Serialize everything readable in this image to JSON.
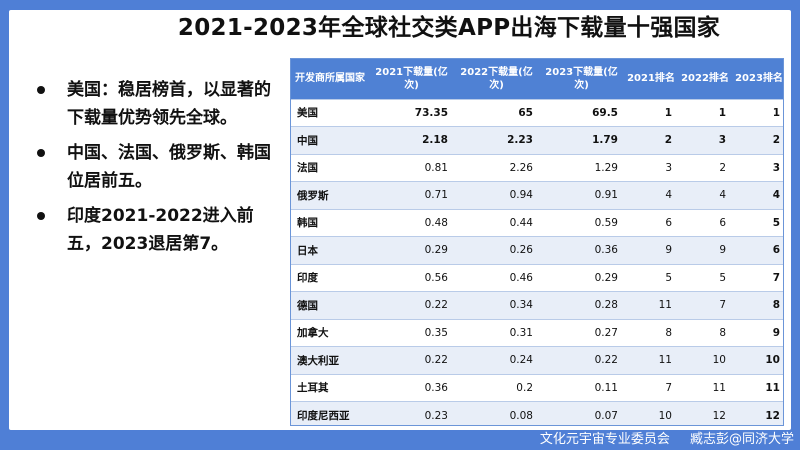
{
  "title": "2021-2023年全球社交类APP出海下载量十强国家",
  "bullets": [
    "美国：稳居榜首，以显著的下载量优势领先全球。",
    "中国、法国、俄罗斯、韩国位居前五。",
    "印度2021-2022进入前五，2023退居第7。"
  ],
  "table": {
    "headers": [
      "开发商所属国家",
      "2021下载量(亿次)",
      "2022下载量(亿次)",
      "2023下载量(亿次)",
      "2021排名",
      "2022排名",
      "2023排名"
    ],
    "rows": [
      {
        "country": "美国",
        "d2021": "73.35",
        "d2022": "65",
        "d2023": "69.5",
        "r2021": "1",
        "r2022": "1",
        "r2023": "1",
        "bold": true
      },
      {
        "country": "中国",
        "d2021": "2.18",
        "d2022": "2.23",
        "d2023": "1.79",
        "r2021": "2",
        "r2022": "3",
        "r2023": "2",
        "bold": true
      },
      {
        "country": "法国",
        "d2021": "0.81",
        "d2022": "2.26",
        "d2023": "1.29",
        "r2021": "3",
        "r2022": "2",
        "r2023": "3",
        "bold": false
      },
      {
        "country": "俄罗斯",
        "d2021": "0.71",
        "d2022": "0.94",
        "d2023": "0.91",
        "r2021": "4",
        "r2022": "4",
        "r2023": "4",
        "bold": false
      },
      {
        "country": "韩国",
        "d2021": "0.48",
        "d2022": "0.44",
        "d2023": "0.59",
        "r2021": "6",
        "r2022": "6",
        "r2023": "5",
        "bold": false
      },
      {
        "country": "日本",
        "d2021": "0.29",
        "d2022": "0.26",
        "d2023": "0.36",
        "r2021": "9",
        "r2022": "9",
        "r2023": "6",
        "bold": false
      },
      {
        "country": "印度",
        "d2021": "0.56",
        "d2022": "0.46",
        "d2023": "0.29",
        "r2021": "5",
        "r2022": "5",
        "r2023": "7",
        "bold": false
      },
      {
        "country": "德国",
        "d2021": "0.22",
        "d2022": "0.34",
        "d2023": "0.28",
        "r2021": "11",
        "r2022": "7",
        "r2023": "8",
        "bold": false
      },
      {
        "country": "加拿大",
        "d2021": "0.35",
        "d2022": "0.31",
        "d2023": "0.27",
        "r2021": "8",
        "r2022": "8",
        "r2023": "9",
        "bold": false
      },
      {
        "country": "澳大利亚",
        "d2021": "0.22",
        "d2022": "0.24",
        "d2023": "0.22",
        "r2021": "11",
        "r2022": "10",
        "r2023": "10",
        "bold": false
      },
      {
        "country": "土耳其",
        "d2021": "0.36",
        "d2022": "0.2",
        "d2023": "0.11",
        "r2021": "7",
        "r2022": "11",
        "r2023": "11",
        "bold": false
      },
      {
        "country": "印度尼西亚",
        "d2021": "0.23",
        "d2022": "0.08",
        "d2023": "0.07",
        "r2021": "10",
        "r2022": "12",
        "r2023": "12",
        "bold": false
      }
    ]
  },
  "footer": {
    "org": "文化元宇宙专业委员会",
    "author": "臧志彭@同济大学"
  },
  "colors": {
    "background": "#4F7FD6",
    "header": "#4F81D4",
    "row_alt": "#E8EEF8"
  }
}
